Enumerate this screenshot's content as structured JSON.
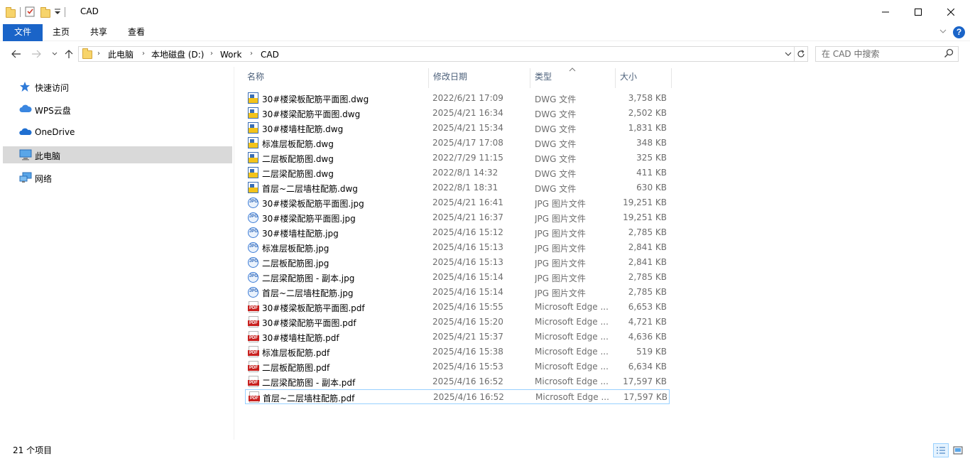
{
  "window": {
    "title": "CAD"
  },
  "ribbon": {
    "tabs": [
      {
        "label": "文件"
      },
      {
        "label": "主页"
      },
      {
        "label": "共享"
      },
      {
        "label": "查看"
      }
    ],
    "help_label": "?"
  },
  "address": {
    "crumbs": [
      "此电脑",
      "本地磁盘 (D:)",
      "Work",
      "CAD"
    ]
  },
  "search": {
    "placeholder": "在 CAD 中搜索"
  },
  "sidebar": {
    "items": [
      {
        "label": "快速访问",
        "icon": "star-icon"
      },
      {
        "label": "WPS云盘",
        "icon": "wps-cloud-icon"
      },
      {
        "label": "OneDrive",
        "icon": "onedrive-icon"
      },
      {
        "label": "此电脑",
        "icon": "computer-icon",
        "selected": true
      },
      {
        "label": "网络",
        "icon": "network-icon"
      }
    ]
  },
  "columns": {
    "name": "名称",
    "date": "修改日期",
    "type": "类型",
    "size": "大小"
  },
  "files": [
    {
      "name": "30#楼梁板配筋平面图.dwg",
      "date": "2022/6/21 17:09",
      "type": "DWG 文件",
      "size": "3,758 KB",
      "kind": "dwg"
    },
    {
      "name": "30#楼梁配筋平面图.dwg",
      "date": "2025/4/21 16:34",
      "type": "DWG 文件",
      "size": "2,502 KB",
      "kind": "dwg"
    },
    {
      "name": "30#楼墙柱配筋.dwg",
      "date": "2025/4/21 15:34",
      "type": "DWG 文件",
      "size": "1,831 KB",
      "kind": "dwg"
    },
    {
      "name": "标准层板配筋.dwg",
      "date": "2025/4/17 17:08",
      "type": "DWG 文件",
      "size": "348 KB",
      "kind": "dwg"
    },
    {
      "name": "二层板配筋图.dwg",
      "date": "2022/7/29 11:15",
      "type": "DWG 文件",
      "size": "325 KB",
      "kind": "dwg"
    },
    {
      "name": "二层梁配筋图.dwg",
      "date": "2022/8/1 14:32",
      "type": "DWG 文件",
      "size": "411 KB",
      "kind": "dwg"
    },
    {
      "name": "首层~二层墙柱配筋.dwg",
      "date": "2022/8/1 18:31",
      "type": "DWG 文件",
      "size": "630 KB",
      "kind": "dwg"
    },
    {
      "name": "30#楼梁板配筋平面图.jpg",
      "date": "2025/4/21 16:41",
      "type": "JPG 图片文件",
      "size": "19,251 KB",
      "kind": "jpg"
    },
    {
      "name": "30#楼梁配筋平面图.jpg",
      "date": "2025/4/21 16:37",
      "type": "JPG 图片文件",
      "size": "19,251 KB",
      "kind": "jpg"
    },
    {
      "name": "30#楼墙柱配筋.jpg",
      "date": "2025/4/16 15:12",
      "type": "JPG 图片文件",
      "size": "2,785 KB",
      "kind": "jpg"
    },
    {
      "name": "标准层板配筋.jpg",
      "date": "2025/4/16 15:13",
      "type": "JPG 图片文件",
      "size": "2,841 KB",
      "kind": "jpg"
    },
    {
      "name": "二层板配筋图.jpg",
      "date": "2025/4/16 15:13",
      "type": "JPG 图片文件",
      "size": "2,841 KB",
      "kind": "jpg"
    },
    {
      "name": "二层梁配筋图 - 副本.jpg",
      "date": "2025/4/16 15:14",
      "type": "JPG 图片文件",
      "size": "2,785 KB",
      "kind": "jpg"
    },
    {
      "name": "首层~二层墙柱配筋.jpg",
      "date": "2025/4/16 15:14",
      "type": "JPG 图片文件",
      "size": "2,785 KB",
      "kind": "jpg"
    },
    {
      "name": "30#楼梁板配筋平面图.pdf",
      "date": "2025/4/16 15:55",
      "type": "Microsoft Edge ...",
      "size": "6,653 KB",
      "kind": "pdf"
    },
    {
      "name": "30#楼梁配筋平面图.pdf",
      "date": "2025/4/16 15:20",
      "type": "Microsoft Edge ...",
      "size": "4,721 KB",
      "kind": "pdf"
    },
    {
      "name": "30#楼墙柱配筋.pdf",
      "date": "2025/4/21 15:37",
      "type": "Microsoft Edge ...",
      "size": "4,636 KB",
      "kind": "pdf"
    },
    {
      "name": "标准层板配筋.pdf",
      "date": "2025/4/16 15:38",
      "type": "Microsoft Edge ...",
      "size": "519 KB",
      "kind": "pdf"
    },
    {
      "name": "二层板配筋图.pdf",
      "date": "2025/4/16 15:53",
      "type": "Microsoft Edge ...",
      "size": "6,634 KB",
      "kind": "pdf"
    },
    {
      "name": "二层梁配筋图 - 副本.pdf",
      "date": "2025/4/16 16:52",
      "type": "Microsoft Edge ...",
      "size": "17,597 KB",
      "kind": "pdf"
    },
    {
      "name": "首层~二层墙柱配筋.pdf",
      "date": "2025/4/16 16:52",
      "type": "Microsoft Edge ...",
      "size": "17,597 KB",
      "kind": "pdf",
      "selected": true
    }
  ],
  "status": {
    "count_text": "21 个项目"
  },
  "colors": {
    "accent": "#1a64c8",
    "selection_border": "#99d1ff",
    "sidebar_selected": "#d9d9d9"
  }
}
